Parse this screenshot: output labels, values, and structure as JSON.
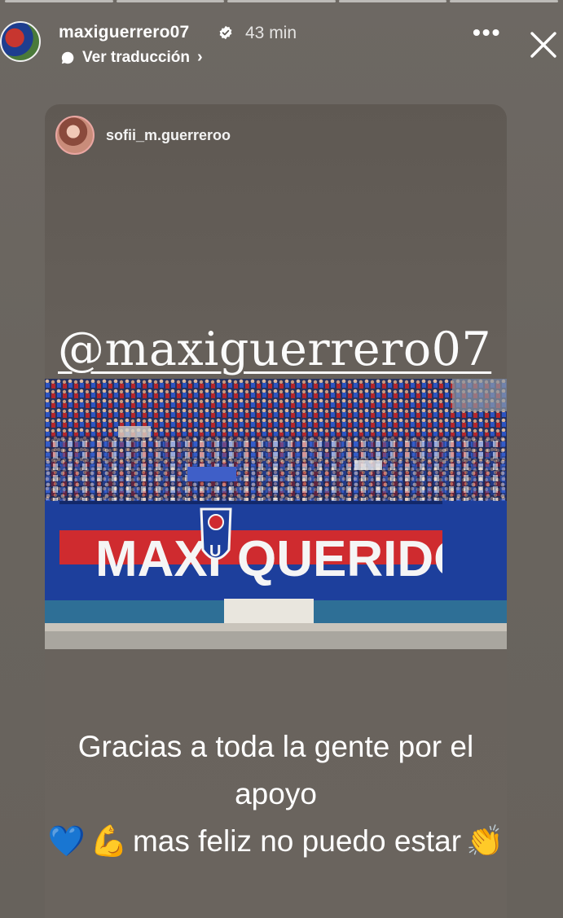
{
  "story": {
    "username": "maxiguerrero07",
    "time_ago": "43 min",
    "translate_label": "Ver traducción",
    "more_label": "•••"
  },
  "shared_post": {
    "username": "sofii_m.guerreroo",
    "mention": "@maxiguerrero07",
    "banner": {
      "left_word": "MAXI",
      "right_word": "QUERIDO",
      "crest_letter": "U",
      "colors": {
        "blue": "#1d3f9c",
        "red": "#cf2b2f",
        "white": "#f5f5f5"
      }
    },
    "caption_line1": "Gracias a toda la gente por el apoyo",
    "caption_line2": "mas feliz no puedo estar",
    "emojis": {
      "heart": "💙",
      "muscle": "💪",
      "clap": "👏"
    }
  }
}
